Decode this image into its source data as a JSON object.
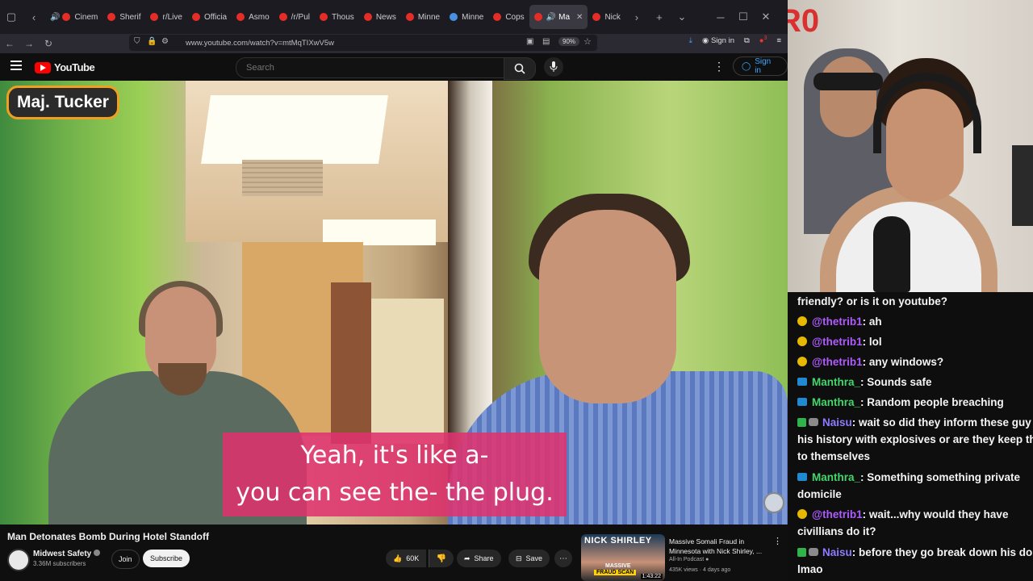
{
  "browser": {
    "tabs": [
      {
        "label": "Cinem"
      },
      {
        "label": "Sherif"
      },
      {
        "label": "r/Live"
      },
      {
        "label": "Officia"
      },
      {
        "label": "Asmo"
      },
      {
        "label": "/r/Pul"
      },
      {
        "label": "Thous"
      },
      {
        "label": "News"
      },
      {
        "label": "Minne"
      },
      {
        "label": "Minne"
      },
      {
        "label": "Cops"
      },
      {
        "label": "Ma"
      },
      {
        "label": "Nick"
      }
    ],
    "url": "www.youtube.com/watch?v=mtMqTIXwV5w",
    "zoom": "90%",
    "sign_in": "Sign in",
    "badge_count": "3"
  },
  "youtube": {
    "logo": "YouTube",
    "search_placeholder": "Search",
    "sign_in": "Sign in"
  },
  "video": {
    "name_tag": "Maj. Tucker",
    "subtitle_line1": "Yeah, it's like a-",
    "subtitle_line2": "you can see the- the plug.",
    "title": "Man Detonates Bomb During Hotel Standoff",
    "channel": "Midwest Safety",
    "subscribers": "3.36M subscribers",
    "join": "Join",
    "subscribe": "Subscribe",
    "likes": "60K",
    "share": "Share",
    "save": "Save"
  },
  "recommended": {
    "thumb_title": "NICK SHIRLEY",
    "thumb_tag": "FRAUD SCAN",
    "thumb_tag_top": "MASSIVE",
    "duration": "1:43:22",
    "title": "Massive Somali Fraud in Minnesota with Nick Shirley, ...",
    "channel": "All-In Podcast",
    "meta": "435K views · 4 days ago"
  },
  "webcam": {
    "bg_text": "R0"
  },
  "chat": {
    "messages": [
      {
        "user": "",
        "text": "friendly? or is it on youtube?"
      },
      {
        "user": "@thetrib1",
        "text": ": ah"
      },
      {
        "user": "@thetrib1",
        "text": ": lol"
      },
      {
        "user": "@thetrib1",
        "text": ": any windows?"
      },
      {
        "user": "Manthra_",
        "text": ": Sounds safe"
      },
      {
        "user": "Manthra_",
        "text": ": Random people breaching"
      },
      {
        "user": "Naisu",
        "text": ": wait so did they inform these guy of his history with explosives or are they keep that to themselves"
      },
      {
        "user": "Manthra_",
        "text": ": Something something private domicile"
      },
      {
        "user": "@thetrib1",
        "text": ": wait...why would they have civillians do it?"
      },
      {
        "user": "Naisu",
        "text": ": before they go break down his do lmao"
      }
    ]
  },
  "colors": {
    "youtube_red": "#ff0000",
    "link_blue": "#3ea6ff",
    "subtitle_pink": "#de326e",
    "nametag_orange": "#f0a020",
    "chat_purple": "#b05bff",
    "chat_green": "#45d66b"
  }
}
